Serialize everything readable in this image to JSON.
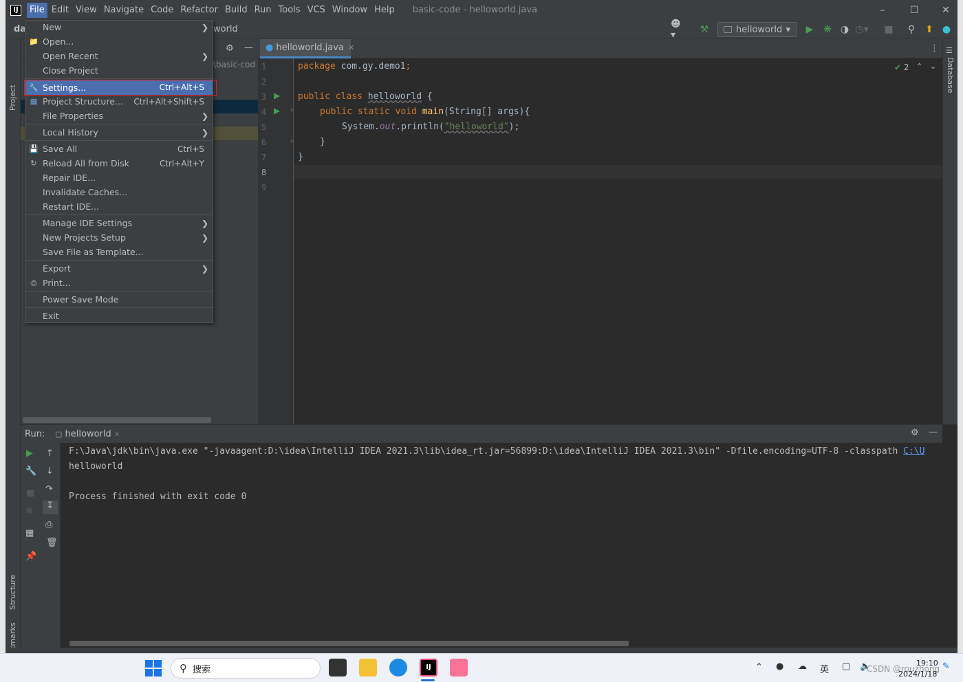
{
  "menubar": {
    "items": [
      "File",
      "Edit",
      "View",
      "Navigate",
      "Code",
      "Refactor",
      "Build",
      "Run",
      "Tools",
      "VCS",
      "Window",
      "Help"
    ],
    "window_title": "basic-code - helloworld.java"
  },
  "breadcrumb": {
    "project": "day",
    "file": "world"
  },
  "project_path": "\\basic-cod",
  "run_config": "helloworld",
  "left_tools": {
    "project": "Project",
    "structure": "Structure",
    "bookmarks": "Bookmarks"
  },
  "right_tools": {
    "database": "Database"
  },
  "editor": {
    "tab": "helloworld.java",
    "inspection_count": "2",
    "line_numbers": [
      "1",
      "2",
      "3",
      "4",
      "5",
      "6",
      "7",
      "8",
      "9"
    ],
    "code": {
      "l1_kw": "package",
      "l1_rest": " com.gy.demo1",
      "l1_semi": ";",
      "l3_kw": "public class ",
      "l3_name": "helloworld",
      "l3_rest": " {",
      "l4_kw": "public static void ",
      "l4_fn": "main",
      "l4_rest": "(String[] args){",
      "l5_a": "System.",
      "l5_out": "out",
      "l5_b": ".println(",
      "l5_str": "\"helloworld\"",
      "l5_c": ");",
      "l6": "}",
      "l7": "}"
    }
  },
  "run": {
    "label": "Run:",
    "tab": "helloworld",
    "lines": [
      "F:\\Java\\jdk\\bin\\java.exe \"-javaagent:D:\\idea\\IntelliJ IDEA 2021.3\\lib\\idea_rt.jar=56899:D:\\idea\\IntelliJ IDEA 2021.3\\bin\" -Dfile.encoding=UTF-8 -classpath",
      "helloworld",
      "",
      "Process finished with exit code 0"
    ],
    "link": "C:\\U"
  },
  "file_menu": {
    "items": [
      {
        "label": "New",
        "shortcut": "",
        "submenu": true
      },
      {
        "label": "Open...",
        "shortcut": "",
        "submenu": false
      },
      {
        "label": "Open Recent",
        "shortcut": "",
        "submenu": true
      },
      {
        "label": "Close Project",
        "shortcut": "",
        "submenu": false
      },
      {
        "label": "Settings...",
        "shortcut": "Ctrl+Alt+S",
        "submenu": false
      },
      {
        "label": "Project Structure...",
        "shortcut": "Ctrl+Alt+Shift+S",
        "submenu": false
      },
      {
        "label": "File Properties",
        "shortcut": "",
        "submenu": true
      },
      {
        "label": "Local History",
        "shortcut": "",
        "submenu": true
      },
      {
        "label": "Save All",
        "shortcut": "Ctrl+S",
        "submenu": false
      },
      {
        "label": "Reload All from Disk",
        "shortcut": "Ctrl+Alt+Y",
        "submenu": false
      },
      {
        "label": "Repair IDE...",
        "shortcut": "",
        "submenu": false
      },
      {
        "label": "Invalidate Caches...",
        "shortcut": "",
        "submenu": false
      },
      {
        "label": "Restart IDE...",
        "shortcut": "",
        "submenu": false
      },
      {
        "label": "Manage IDE Settings",
        "shortcut": "",
        "submenu": true
      },
      {
        "label": "New Projects Setup",
        "shortcut": "",
        "submenu": true
      },
      {
        "label": "Save File as Template...",
        "shortcut": "",
        "submenu": false
      },
      {
        "label": "Export",
        "shortcut": "",
        "submenu": true
      },
      {
        "label": "Print...",
        "shortcut": "",
        "submenu": false
      },
      {
        "label": "Power Save Mode",
        "shortcut": "",
        "submenu": false
      },
      {
        "label": "Exit",
        "shortcut": "",
        "submenu": false
      }
    ],
    "selected": "Settings..."
  },
  "taskbar": {
    "search_placeholder": "搜索",
    "ime": "英",
    "time": "19:10",
    "date": "2024/1/18",
    "watermark": "CSDN @rouzhong"
  },
  "colors": {
    "accent": "#4b6eaf",
    "highlight_box": "#e02020",
    "run_green": "#499c54"
  }
}
